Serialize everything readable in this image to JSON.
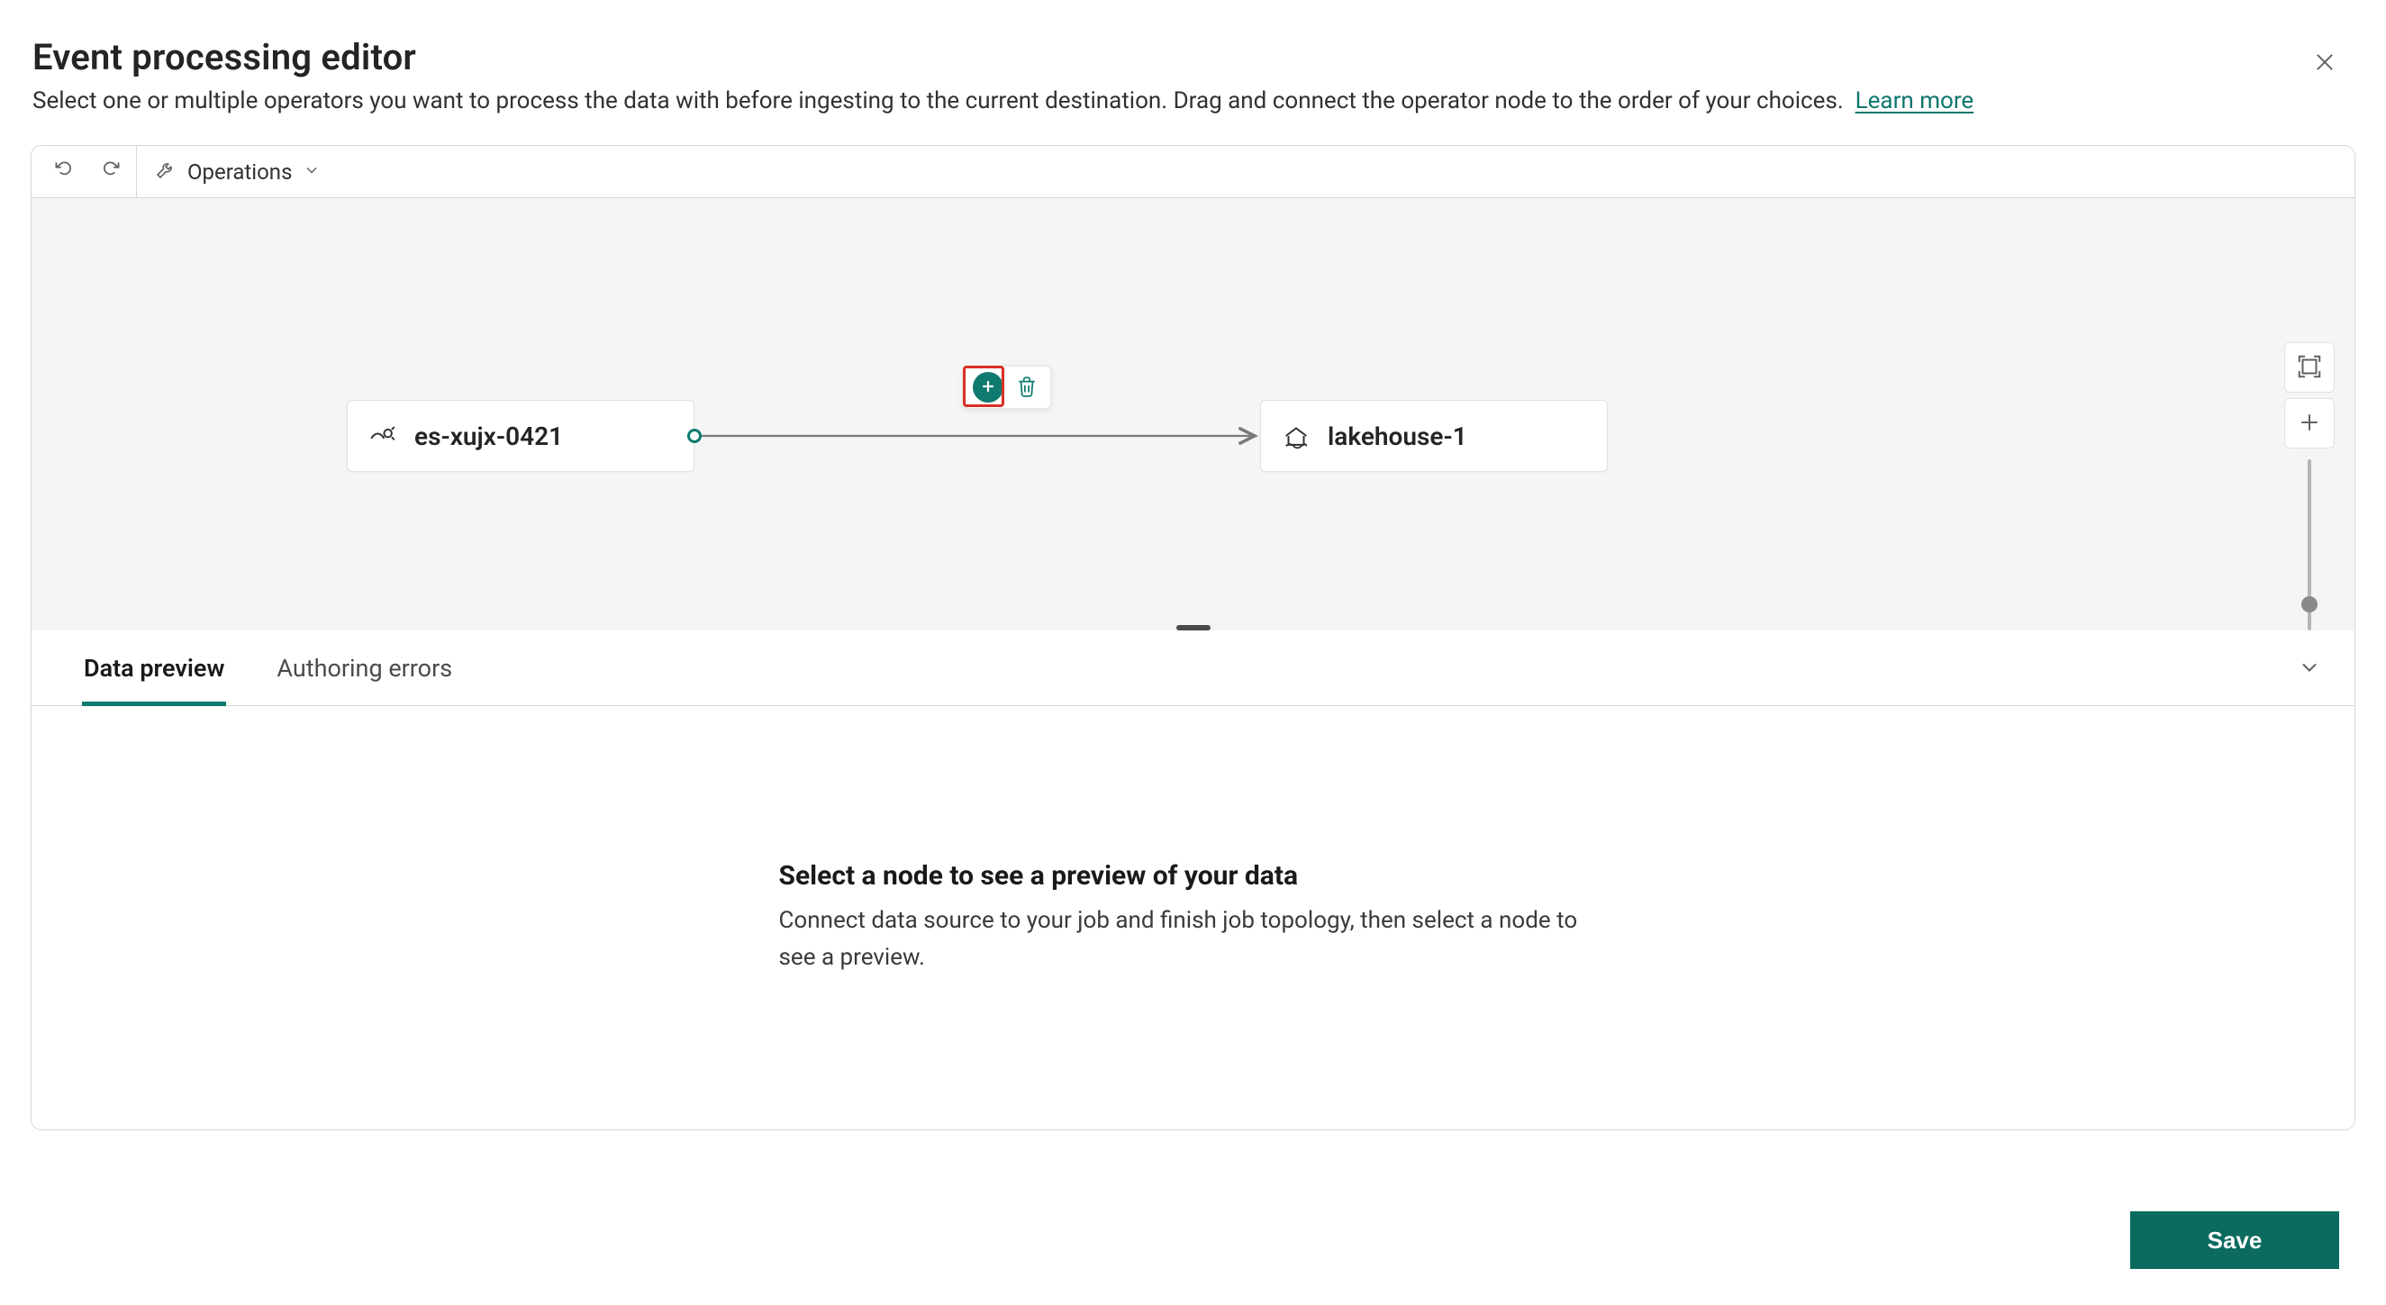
{
  "header": {
    "title": "Event processing editor",
    "subtitle": "Select one or multiple operators you want to process the data with before ingesting to the current destination. Drag and connect the operator node to the order of your choices.",
    "learn_more": "Learn more"
  },
  "toolbar": {
    "operations_label": "Operations"
  },
  "canvas": {
    "source_node": {
      "label": "es-xujx-0421"
    },
    "destination_node": {
      "label": "lakehouse-1"
    }
  },
  "zoom": {
    "thumb_pct": 80
  },
  "tabs": {
    "items": [
      {
        "label": "Data preview",
        "active": true
      },
      {
        "label": "Authoring errors",
        "active": false
      }
    ]
  },
  "preview": {
    "title": "Select a node to see a preview of your data",
    "body": "Connect data source to your job and finish job topology, then select a node to see a preview."
  },
  "footer": {
    "save": "Save"
  }
}
